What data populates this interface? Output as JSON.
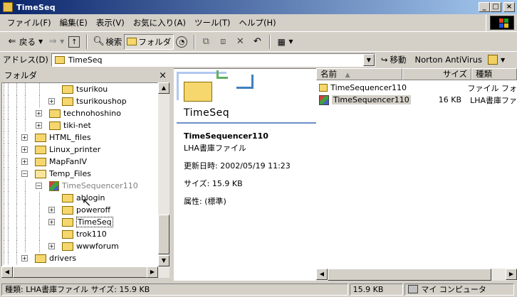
{
  "window": {
    "title": "TimeSeq",
    "min": "_",
    "max": "□",
    "close": "×"
  },
  "menu": [
    "ファイル(F)",
    "編集(E)",
    "表示(V)",
    "お気に入り(A)",
    "ツール(T)",
    "ヘルプ(H)"
  ],
  "toolbar": {
    "back": "戻る",
    "search": "検索",
    "folders": "フォルダ"
  },
  "address": {
    "label": "アドレス(D)",
    "value": "TimeSeq",
    "go": "移動",
    "norton": "Norton AntiVirus"
  },
  "left_pane": {
    "title": "フォルダ",
    "close": "×"
  },
  "tree": [
    {
      "label": "tsurikou",
      "level": 3,
      "expander": ""
    },
    {
      "label": "tsurikoushop",
      "level": 3,
      "expander": "+"
    },
    {
      "label": "technohoshino",
      "level": 2,
      "expander": "+"
    },
    {
      "label": "tiki-net",
      "level": 2,
      "expander": "+"
    },
    {
      "label": "HTML_files",
      "level": 1,
      "expander": "+"
    },
    {
      "label": "Linux_printer",
      "level": 1,
      "expander": "+"
    },
    {
      "label": "MapFanIV",
      "level": 1,
      "expander": "+"
    },
    {
      "label": "Temp_Files",
      "level": 1,
      "expander": "-"
    },
    {
      "label": "TimeSequencer110",
      "level": 2,
      "expander": "-",
      "dragging": true
    },
    {
      "label": "ablogin",
      "level": 3,
      "expander": ""
    },
    {
      "label": "poweroff",
      "level": 3,
      "expander": "+"
    },
    {
      "label": "TimeSeq",
      "level": 3,
      "expander": "+",
      "selected": true
    },
    {
      "label": "trok110",
      "level": 3,
      "expander": ""
    },
    {
      "label": "wwwforum",
      "level": 3,
      "expander": "+"
    },
    {
      "label": "drivers",
      "level": 1,
      "expander": "+"
    }
  ],
  "info": {
    "folder_title": "TimeSeq",
    "file_name": "TimeSequencer110",
    "file_type": "LHA書庫ファイル",
    "modified": "更新日時: 2002/05/19 11:23",
    "size": "サイズ: 15.9 KB",
    "attr": "属性: (標準)"
  },
  "list": {
    "headers": {
      "name": "名前",
      "size": "サイズ",
      "type": "種類"
    },
    "rows": [
      {
        "name": "TimeSequencer110",
        "size": "",
        "type": "ファイル フォ",
        "icon": "folder-icon"
      },
      {
        "name": "TimeSequencer110",
        "size": "16 KB",
        "type": "LHA書庫ファ",
        "icon": "lha-archive-icon"
      }
    ]
  },
  "status": {
    "left": "種類: LHA書庫ファイル サイズ: 15.9 KB",
    "size": "15.9 KB",
    "location": "マイ コンピュータ"
  }
}
